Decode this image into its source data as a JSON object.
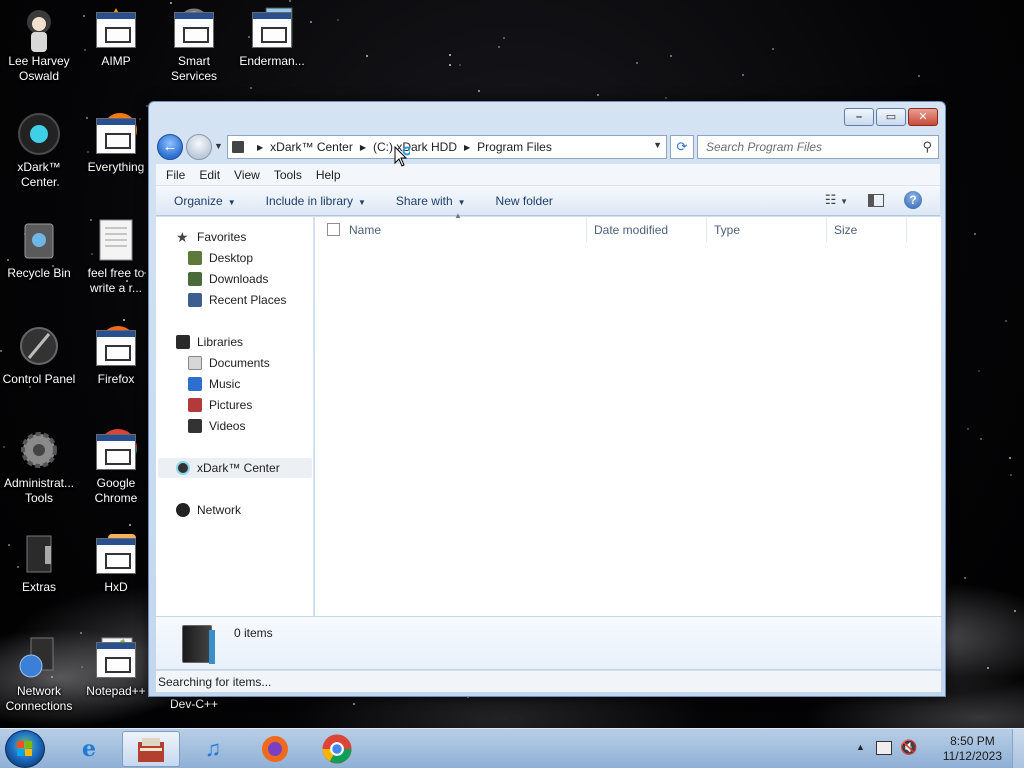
{
  "desktop": {
    "icons": [
      {
        "label": "Lee Harvey Oswald",
        "icon": "avatar-icon"
      },
      {
        "label": "AIMP",
        "icon": "aimp-icon"
      },
      {
        "label": "Smart Services",
        "icon": "smart-services-icon"
      },
      {
        "label": "Enderman...",
        "icon": "enderman-icon"
      },
      {
        "label": "xDark™ Center",
        "icon": "xdark-center-icon"
      },
      {
        "label": "Everything",
        "icon": "everything-icon"
      },
      {
        "label": "Recycle Bin",
        "icon": "recycle-bin-icon"
      },
      {
        "label": "feel free to write a r...",
        "icon": "text-document-icon"
      },
      {
        "label": "Control Panel",
        "icon": "control-panel-icon"
      },
      {
        "label": "Firefox",
        "icon": "firefox-icon"
      },
      {
        "label": "Administrat... Tools",
        "icon": "admin-tools-icon"
      },
      {
        "label": "Google Chrome",
        "icon": "chrome-icon"
      },
      {
        "label": "Extras",
        "icon": "extras-icon"
      },
      {
        "label": "HxD",
        "icon": "hxd-icon"
      },
      {
        "label": "Network Connections",
        "icon": "network-connections-icon"
      },
      {
        "label": "Notepad++",
        "icon": "notepad-plus-plus-icon"
      },
      {
        "label": "Dev-C++",
        "icon": "dev-cpp-icon"
      }
    ]
  },
  "window": {
    "breadcrumbs": [
      "xDark™ Center",
      "(C:) xDark HDD",
      "Program Files"
    ],
    "search_placeholder": "Search Program Files",
    "menu": [
      "File",
      "Edit",
      "View",
      "Tools",
      "Help"
    ],
    "toolbar": {
      "organize": "Organize",
      "include_in_library": "Include in library",
      "share_with": "Share with",
      "new_folder": "New folder"
    },
    "nav": {
      "favorites": "Favorites",
      "desktop": "Desktop",
      "downloads": "Downloads",
      "recent_places": "Recent Places",
      "libraries": "Libraries",
      "documents": "Documents",
      "music": "Music",
      "pictures": "Pictures",
      "videos": "Videos",
      "xdark_center": "xDark™ Center",
      "network": "Network"
    },
    "columns": [
      "Name",
      "Date modified",
      "Type",
      "Size"
    ],
    "item_count": "0 items",
    "status": "Searching for items..."
  },
  "taskbar": {
    "time": "8:50 PM",
    "date": "11/12/2023"
  },
  "colors": {
    "accent": "#2d6fd0",
    "link_text": "#1e3e6b",
    "window_frame": "#c2d6ee"
  }
}
